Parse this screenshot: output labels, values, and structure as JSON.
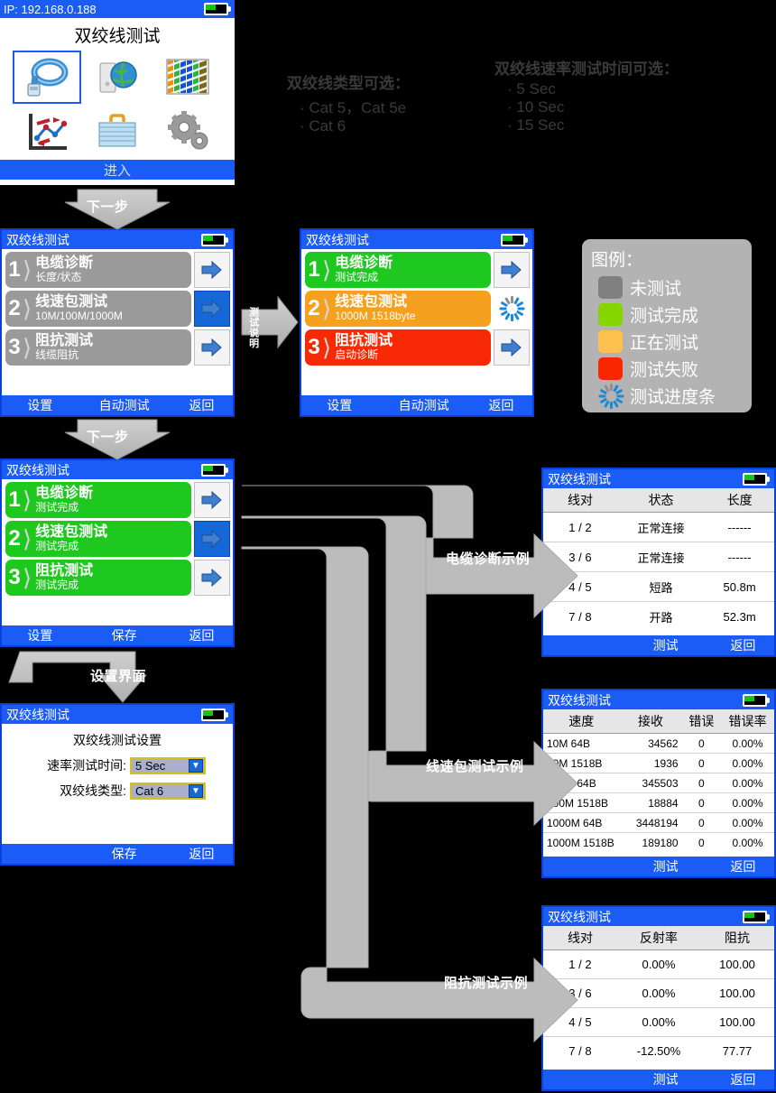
{
  "home": {
    "ip": "IP: 192.168.0.188",
    "title": "双绞线测试",
    "icons": [
      "cable-icon",
      "network-pc-icon",
      "wire-pairs-icon",
      "chart-icon",
      "toolbox-icon",
      "gears-icon"
    ],
    "enter_label": "进入"
  },
  "notes": {
    "cable_types": {
      "heading": "双绞线类型可选：",
      "items": [
        "Cat 5，Cat 5e",
        "Cat 6"
      ]
    },
    "speed_times": {
      "heading": "双绞线速率测试时间可选：",
      "items": [
        "5 Sec",
        "10 Sec",
        "15 Sec"
      ]
    }
  },
  "flow_labels": {
    "next_step_1": "下一步",
    "next_step_2": "下一步",
    "test_desc": "测试说明",
    "settings_ui": "设置界面",
    "cable_example": "电缆诊断示例",
    "speed_example": "线速包测试示例",
    "impedance_example": "阻抗测试示例"
  },
  "screen_menu_idle": {
    "title": "双绞线测试",
    "rows": [
      {
        "num": "1",
        "t1": "电缆诊断",
        "t2": "长度/状态",
        "color": "gray",
        "selected": false
      },
      {
        "num": "2",
        "t1": "线速包测试",
        "t2": "10M/100M/1000M",
        "color": "gray",
        "selected": true
      },
      {
        "num": "3",
        "t1": "阻抗测试",
        "t2": "线缆阻抗",
        "color": "gray",
        "selected": false
      }
    ],
    "footer": [
      "设置",
      "自动测试",
      "返回"
    ]
  },
  "screen_menu_running": {
    "title": "双绞线测试",
    "rows": [
      {
        "num": "1",
        "t1": "电缆诊断",
        "t2": "测试完成",
        "color": "green",
        "icon": "arrow-right-icon"
      },
      {
        "num": "2",
        "t1": "线速包测试",
        "t2": "1000M 1518byte",
        "color": "orange",
        "icon": "spinner-icon"
      },
      {
        "num": "3",
        "t1": "阻抗测试",
        "t2": "启动诊断",
        "color": "red",
        "icon": "arrow-right-icon"
      }
    ],
    "footer": [
      "设置",
      "自动测试",
      "返回"
    ]
  },
  "screen_menu_done": {
    "title": "双绞线测试",
    "rows": [
      {
        "num": "1",
        "t1": "电缆诊断",
        "t2": "测试完成",
        "color": "green",
        "selected": false
      },
      {
        "num": "2",
        "t1": "线速包测试",
        "t2": "测试完成",
        "color": "green",
        "selected": true
      },
      {
        "num": "3",
        "t1": "阻抗测试",
        "t2": "测试完成",
        "color": "green",
        "selected": false
      }
    ],
    "footer": [
      "设置",
      "保存",
      "返回"
    ]
  },
  "legend": {
    "title": "图例：",
    "items": [
      {
        "label": "未测试",
        "color": "#808080"
      },
      {
        "label": "测试完成",
        "color": "#86d400"
      },
      {
        "label": "正在测试",
        "color": "#ffc04d"
      },
      {
        "label": "测试失败",
        "color": "#fa2600"
      },
      {
        "label": "测试进度条",
        "color": "spinner"
      }
    ]
  },
  "screen_settings": {
    "title": "双绞线测试",
    "heading": "双绞线测试设置",
    "fields": [
      {
        "label": "速率测试时间:",
        "value": "5 Sec"
      },
      {
        "label": "双绞线类型:",
        "value": "Cat 6"
      }
    ],
    "footer": [
      "",
      "保存",
      "返回"
    ]
  },
  "table_cable": {
    "title": "双绞线测试",
    "headers": [
      "线对",
      "状态",
      "长度"
    ],
    "rows": [
      [
        "1 / 2",
        "正常连接",
        "------"
      ],
      [
        "3 / 6",
        "正常连接",
        "------"
      ],
      [
        "4 / 5",
        "短路",
        "50.8m"
      ],
      [
        "7 / 8",
        "开路",
        "52.3m"
      ]
    ],
    "footer": [
      "",
      "测试",
      "返回"
    ]
  },
  "table_speed": {
    "title": "双绞线测试",
    "headers": [
      "速度",
      "接收",
      "错误",
      "错误率"
    ],
    "rows": [
      [
        "10M  64B",
        "34562",
        "0",
        "0.00%"
      ],
      [
        "10M  1518B",
        "1936",
        "0",
        "0.00%"
      ],
      [
        "100M  64B",
        "345503",
        "0",
        "0.00%"
      ],
      [
        "100M  1518B",
        "18884",
        "0",
        "0.00%"
      ],
      [
        "1000M  64B",
        "3448194",
        "0",
        "0.00%"
      ],
      [
        "1000M  1518B",
        "189180",
        "0",
        "0.00%"
      ]
    ],
    "footer": [
      "",
      "测试",
      "返回"
    ]
  },
  "table_impedance": {
    "title": "双绞线测试",
    "headers": [
      "线对",
      "反射率",
      "阻抗"
    ],
    "rows": [
      [
        "1 / 2",
        "0.00%",
        "100.00"
      ],
      [
        "3 / 6",
        "0.00%",
        "100.00"
      ],
      [
        "4 / 5",
        "0.00%",
        "100.00"
      ],
      [
        "7 / 8",
        "-12.50%",
        "77.77"
      ]
    ],
    "footer": [
      "",
      "测试",
      "返回"
    ]
  },
  "colors": {
    "accent_blue": "#1a5cf5",
    "border_blue": "#0a3fd8",
    "gray_chip": "#9a9a9a",
    "green_chip": "#1fc81f",
    "orange_chip": "#f5a01e",
    "red_chip": "#f82a05",
    "connector_gray": "#b7b7b7"
  }
}
